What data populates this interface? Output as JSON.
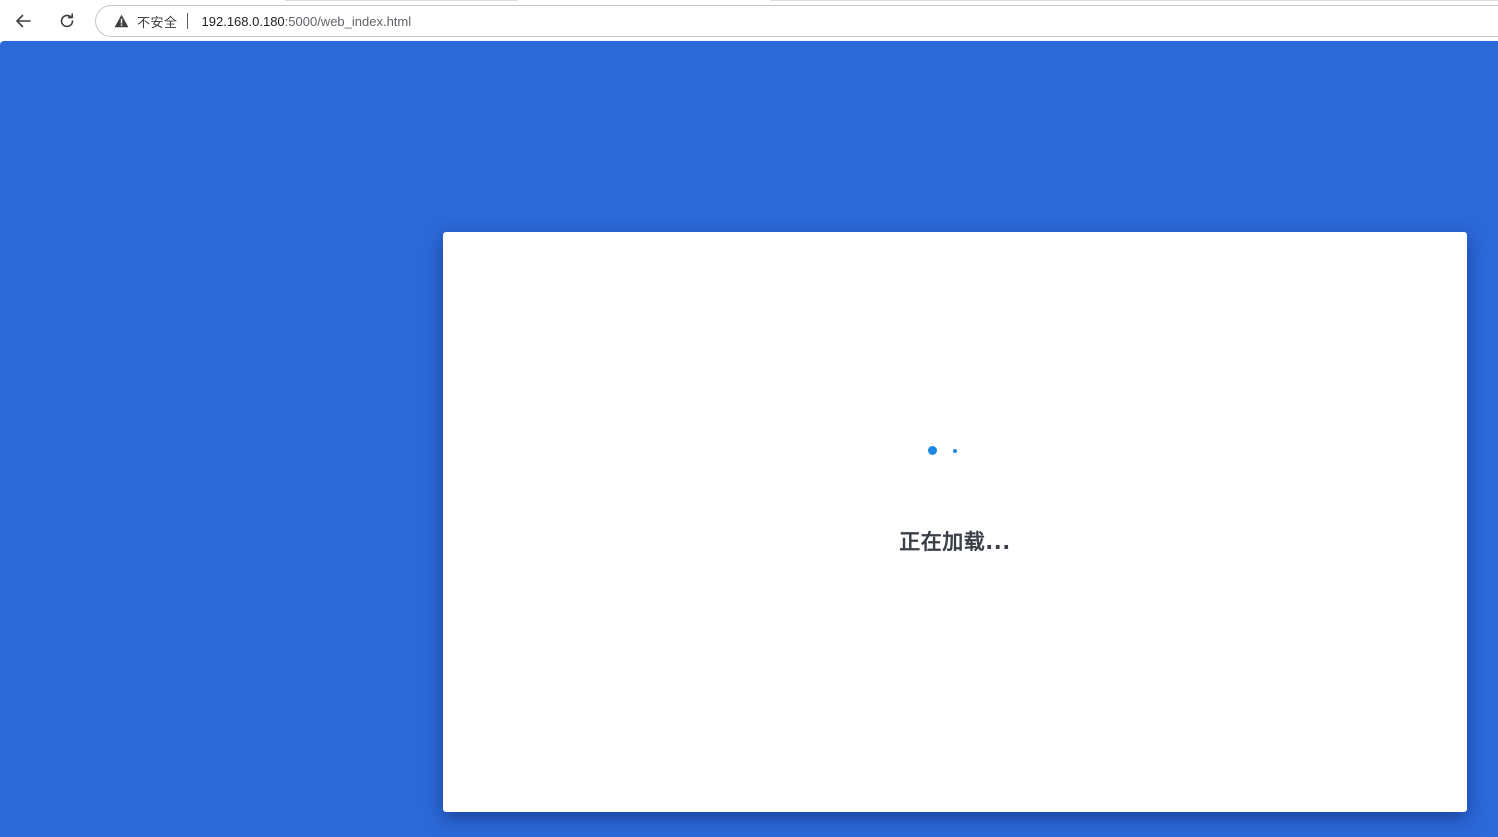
{
  "browser": {
    "security_label": "不安全",
    "url_host": "192.168.0.180",
    "url_rest": ":5000/web_index.html",
    "icons": {
      "back": "back-arrow-icon",
      "reload": "reload-icon",
      "warning": "warning-triangle-icon"
    }
  },
  "page": {
    "loading_text": "正在加载...",
    "colors": {
      "background": "#2b68d8",
      "card": "#ffffff",
      "spinner": "#1e88e5",
      "text": "#3a3f47"
    }
  }
}
